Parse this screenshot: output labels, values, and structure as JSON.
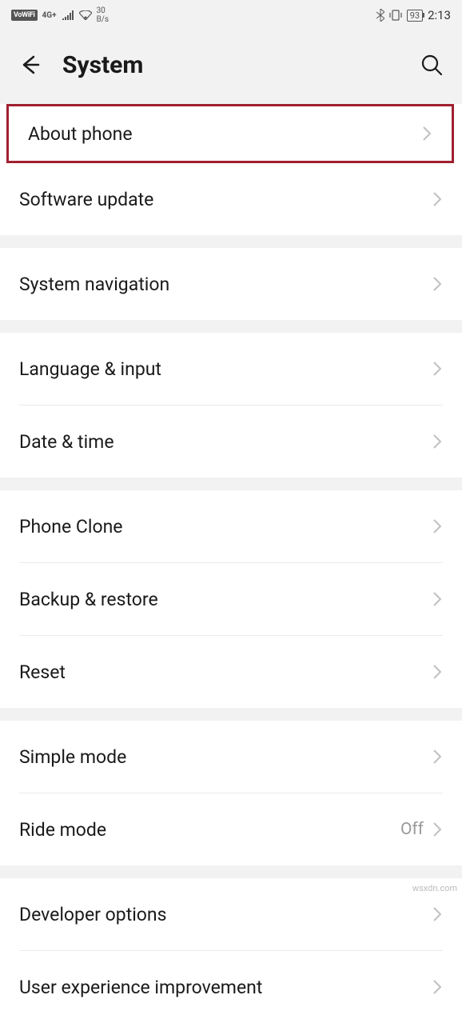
{
  "status_bar": {
    "vowifi": "VoWiFi",
    "signal_gen": "4G+",
    "data_rate_num": "30",
    "data_rate_unit": "B/s",
    "battery": "93",
    "time": "2:13"
  },
  "header": {
    "title": "System"
  },
  "groups": [
    {
      "items": [
        {
          "label": "About phone",
          "highlighted": true
        },
        {
          "label": "Software update"
        }
      ]
    },
    {
      "items": [
        {
          "label": "System navigation"
        }
      ]
    },
    {
      "items": [
        {
          "label": "Language & input"
        },
        {
          "label": "Date & time"
        }
      ]
    },
    {
      "items": [
        {
          "label": "Phone Clone"
        },
        {
          "label": "Backup & restore"
        },
        {
          "label": "Reset"
        }
      ]
    },
    {
      "items": [
        {
          "label": "Simple mode"
        },
        {
          "label": "Ride mode",
          "value": "Off"
        }
      ]
    },
    {
      "items": [
        {
          "label": "Developer options"
        },
        {
          "label": "User experience improvement"
        }
      ]
    }
  ],
  "watermark": "wsxdn.com"
}
